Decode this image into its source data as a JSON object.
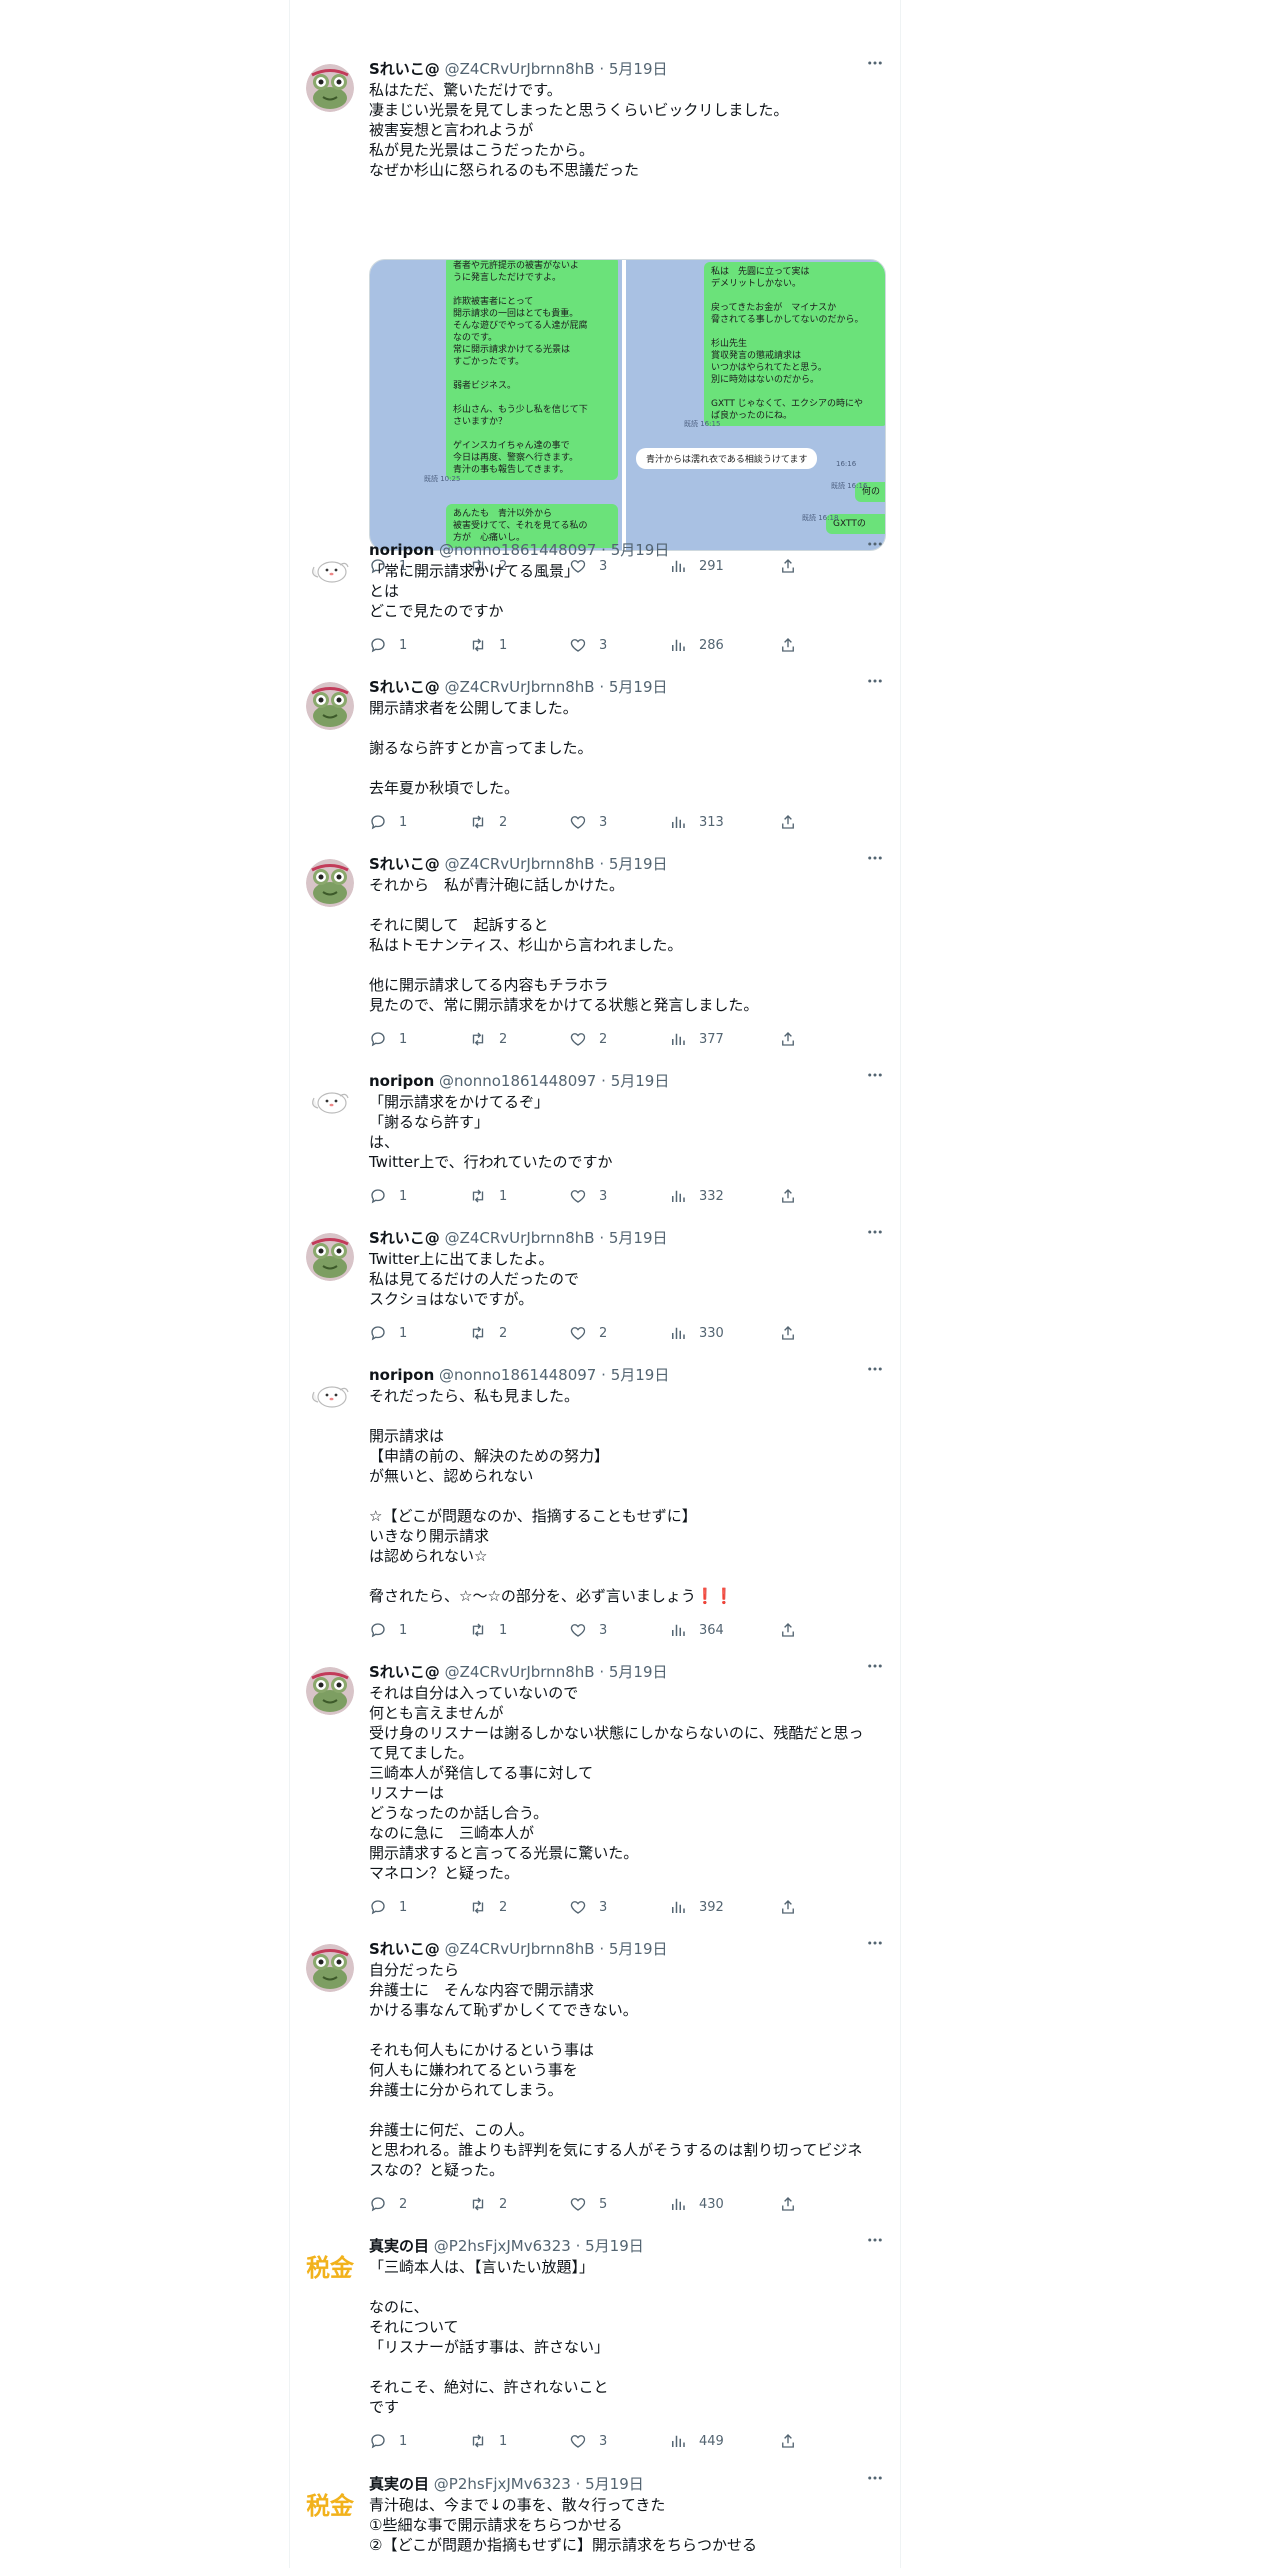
{
  "icons": {
    "more": "more-icon",
    "reply": "reply-icon",
    "retweet": "retweet-icon",
    "like": "like-icon",
    "views": "views-icon",
    "share": "share-icon"
  },
  "colors": {
    "accent": "#1d9bf0",
    "text": "#0f1419",
    "secondary": "#536471",
    "chat_green": "#6be27a",
    "tax_gold": "#f2b21c"
  },
  "tweets": [
    {
      "name": "Sれいこ@",
      "handle": "@Z4CRvUrJbrnn8hB",
      "sep": "·",
      "date": "5月19日",
      "text": "私はただ、驚いただけです。\n凄まじい光景を見てしまったと思うくらいビックリしました。\n被害妄想と言われようが\n私が見た光景はこうだったから。\nなぜか杉山に怒られるのも不思議だった",
      "media": {
        "left_bubble1": "者者や元許提示の被害がないよ\nうに発言しただけですよ。\n\n詐欺被害者にとって\n開示請求の一回はとても貴重。\nそんな遊びでやってる人達が屁腐\nなのです。\n常に開示請求かけてる光景は\nすごかったです。\n\n弱者ビジネス。\n\n杉山さん、もう少し私を信じて下\nさいますか？\n\nゲインスカイちゃん達の事で\n今日は再度、警察へ行きます。\n青汁の事も報告してきます。",
        "left_time1": "既読\n10:25",
        "left_bubble2": "あんたも　青汁以外から\n被害受けてて、それを見てる私の\n方が　心痛いし。",
        "right_bubble1": "私は　先圓に立って実は\nデメリットしかない。\n\n戻ってきたお金が　マイナスか\n脅されてる事しかしてないのだから。\n\n杉山先生\n賞収発言の懲戒請求は\nいつかはやられてたと思う。\n別に時効はないのだから。\n\nGXTT じゃなくて、エクシアの時にや\nば良かったのにね。",
        "right_time1": "既読\n16:15",
        "white_bubble": "青汁からは濡れ衣である相談うけてます",
        "white_time": "16:16",
        "right_small1": "何の",
        "right_time2": "既読\n16:16",
        "right_small2": "GXTTの",
        "right_time3": "既読\n16:18"
      },
      "replies": "1",
      "retweets": "2",
      "likes": "3",
      "views": "291"
    },
    {
      "name": "noripon",
      "handle": "@nonno1861448097",
      "sep": "·",
      "date": "5月19日",
      "text": "「常に開示請求かけてる風景」\nとは\nどこで見たのですか",
      "replies": "1",
      "retweets": "1",
      "likes": "3",
      "views": "286"
    },
    {
      "name": "Sれいこ@",
      "handle": "@Z4CRvUrJbrnn8hB",
      "sep": "·",
      "date": "5月19日",
      "text": "開示請求者を公開してました。\n\n謝るなら許すとか言ってました。\n\n去年夏か秋頃でした。",
      "replies": "1",
      "retweets": "2",
      "likes": "3",
      "views": "313"
    },
    {
      "name": "Sれいこ@",
      "handle": "@Z4CRvUrJbrnn8hB",
      "sep": "·",
      "date": "5月19日",
      "text": "それから　私が青汁砲に話しかけた。\n\nそれに関して　起訴すると\n私はトモナンティス、杉山から言われました。\n\n他に開示請求してる内容もチラホラ\n見たので、常に開示請求をかけてる状態と発言しました。",
      "replies": "1",
      "retweets": "2",
      "likes": "2",
      "views": "377"
    },
    {
      "name": "noripon",
      "handle": "@nonno1861448097",
      "sep": "·",
      "date": "5月19日",
      "text": "「開示請求をかけてるぞ」\n「謝るなら許す」\nは、\nTwitter上で、行われていたのですか",
      "replies": "1",
      "retweets": "1",
      "likes": "3",
      "views": "332"
    },
    {
      "name": "Sれいこ@",
      "handle": "@Z4CRvUrJbrnn8hB",
      "sep": "·",
      "date": "5月19日",
      "text": "Twitter上に出てましたよ。\n私は見てるだけの人だったので\nスクショはないですが。",
      "replies": "1",
      "retweets": "2",
      "likes": "2",
      "views": "330"
    },
    {
      "name": "noripon",
      "handle": "@nonno1861448097",
      "sep": "·",
      "date": "5月19日",
      "text": "それだったら、私も見ました。\n\n開示請求は\n【申請の前の、解決のための努力】\nが無いと、認められない\n\n☆【どこが問題なのか、指摘することもせずに】\nいきなり開示請求\nは認められない☆\n\n脅されたら、☆～☆の部分を、必ず言いましょう",
      "emoji": "❗❗",
      "replies": "1",
      "retweets": "1",
      "likes": "3",
      "views": "364"
    },
    {
      "name": "Sれいこ@",
      "handle": "@Z4CRvUrJbrnn8hB",
      "sep": "·",
      "date": "5月19日",
      "text": "それは自分は入っていないので\n何とも言えませんが\n受け身のリスナーは謝るしかない状態にしかならないのに、残酷だと思っ\nて見てました。\n三崎本人が発信してる事に対して\nリスナーは\nどうなったのか話し合う。\nなのに急に　三崎本人が\n開示請求すると言ってる光景に驚いた。\nマネロン？と疑った。",
      "replies": "1",
      "retweets": "2",
      "likes": "3",
      "views": "392"
    },
    {
      "name": "Sれいこ@",
      "handle": "@Z4CRvUrJbrnn8hB",
      "sep": "·",
      "date": "5月19日",
      "text": "自分だったら\n弁護士に　そんな内容で開示請求\nかける事なんて恥ずかしくてできない。\n\nそれも何人もにかけるという事は\n何人もに嫌われてるという事を\n弁護士に分かられてしまう。\n\n弁護士に何だ、この人。\nと思われる。誰よりも評判を気にする人がそうするのは割り切ってビジネ\nスなの？と疑った。",
      "replies": "2",
      "retweets": "2",
      "likes": "5",
      "views": "430"
    },
    {
      "name": "真実の目",
      "handle": "@P2hsFjxJMv6323",
      "sep": "·",
      "date": "5月19日",
      "avatar_text": "税金",
      "text": "「三崎本人は、【言いたい放題】」\n\nなのに、\nそれについて\n「リスナーが話す事は、許さない」\n\nそれこそ、絶対に、許されないこと\nです",
      "replies": "1",
      "retweets": "1",
      "likes": "3",
      "views": "449"
    },
    {
      "name": "真実の目",
      "handle": "@P2hsFjxJMv6323",
      "sep": "·",
      "date": "5月19日",
      "avatar_text": "税金",
      "text": "青汁砲は、今まで↓の事を、散々行ってきた\n①些細な事で開示請求をちらつかせる\n②【どこが問題か指摘もせずに】開示請求をちらつかせる"
    }
  ]
}
